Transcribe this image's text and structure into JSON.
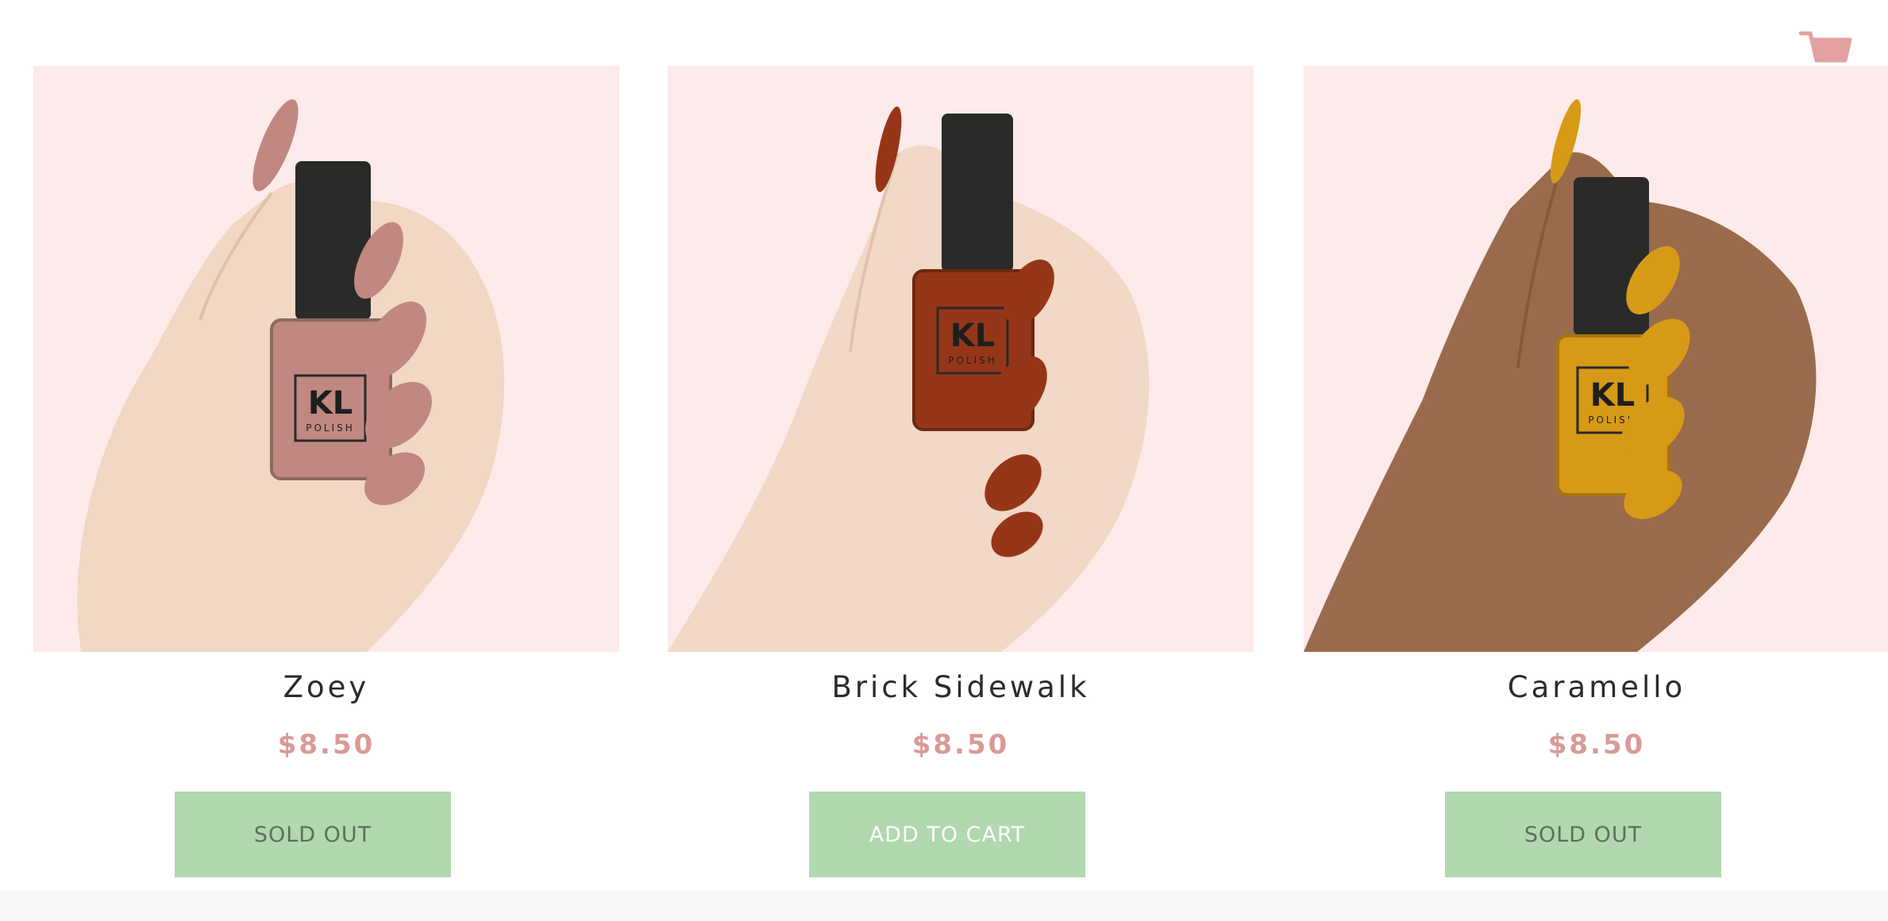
{
  "header": {
    "cart_icon": "shopping-cart-icon",
    "cart_color": "#e3a1a1"
  },
  "products": [
    {
      "name": "Zoey",
      "price": "$8.50",
      "button_label": "SOLD OUT",
      "polish_color": "#c08880",
      "skin_color": "#f1d7c4",
      "bottle_label": "KL",
      "bottle_sublabel": "POLISH"
    },
    {
      "name": "Brick Sidewalk",
      "price": "$8.50",
      "button_label": "ADD TO CART",
      "polish_color": "#963618",
      "skin_color": "#f2d8c6",
      "bottle_label": "KL",
      "bottle_sublabel": "POLISH"
    },
    {
      "name": "Caramello",
      "price": "$8.50",
      "button_label": "SOLD OUT",
      "polish_color": "#d79a16",
      "skin_color": "#9a6a4c",
      "bottle_label": "KL",
      "bottle_sublabel": "POLISH"
    }
  ],
  "colors": {
    "image_background": "#fdeaea",
    "price": "#d99a96",
    "button_background": "#b1d8af"
  }
}
